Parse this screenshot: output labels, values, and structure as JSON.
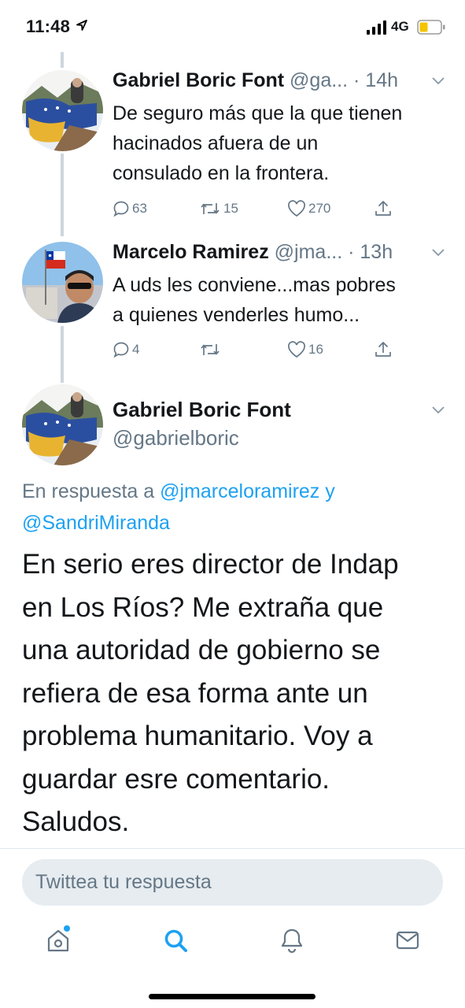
{
  "status_bar": {
    "time": "11:48",
    "network": "4G",
    "location_icon": "location-arrow-icon",
    "battery_color": "#f5c400"
  },
  "colors": {
    "accent": "#1da1f2",
    "muted": "#657786",
    "text": "#14171a"
  },
  "tweets": [
    {
      "name": "Gabriel Boric Font",
      "handle": "@ga...",
      "time": "· 14h",
      "text_lines": [
        "De seguro más que la que tienen",
        "hacinados afuera de un",
        "consulado en la frontera."
      ],
      "replies": "63",
      "retweets": "15",
      "likes": "270"
    },
    {
      "name": "Marcelo Ramirez",
      "handle": "@jma...",
      "time": "· 13h",
      "text_lines": [
        "A uds les conviene...mas pobres",
        "a quienes venderles humo..."
      ],
      "replies": "4",
      "retweets": "",
      "likes": "16"
    }
  ],
  "main_tweet": {
    "name": "Gabriel Boric Font",
    "handle": "@gabrielboric",
    "reply_prefix": "En respuesta a ",
    "reply_user1": "@jmarceloramirez",
    "reply_joiner": " y",
    "reply_user2": "@SandriMiranda",
    "text_lines": [
      "En serio eres director de Indap",
      "en Los Ríos? Me extraña que",
      "una autoridad de gobierno se",
      "refiera de esa forma ante un",
      "problema humanitario. Voy a",
      "guardar esre comentario.",
      "Saludos."
    ]
  },
  "reply_box": {
    "placeholder": "Twittea tu respuesta"
  },
  "tabbar": {
    "items": [
      "home-icon",
      "search-icon",
      "notifications-icon",
      "messages-icon"
    ],
    "active": "search-icon"
  }
}
